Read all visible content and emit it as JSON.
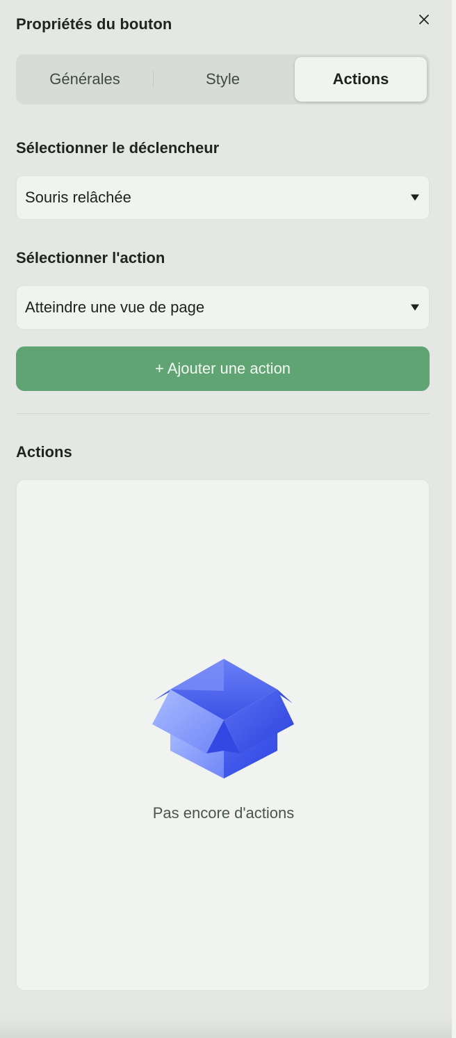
{
  "panel": {
    "title": "Propriétés du bouton",
    "close_icon": "close-icon"
  },
  "tabs": [
    {
      "label": "Générales",
      "active": false
    },
    {
      "label": "Style",
      "active": false
    },
    {
      "label": "Actions",
      "active": true
    }
  ],
  "trigger": {
    "label": "Sélectionner le déclencheur",
    "value": "Souris relâchée"
  },
  "action": {
    "label": "Sélectionner l'action",
    "value": "Atteindre une vue de page"
  },
  "add_button": {
    "label": "+ Ajouter une action",
    "color": "#5fa472"
  },
  "actions_section": {
    "title": "Actions",
    "empty_text": "Pas encore d'actions",
    "empty_icon": "open-box-icon",
    "icon_color": "#4a63f0"
  }
}
